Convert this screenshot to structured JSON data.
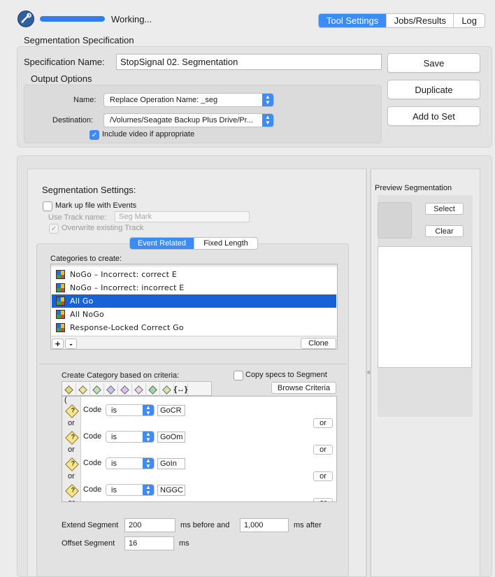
{
  "status": {
    "text": "Working...",
    "progress": 1.0
  },
  "tabs": [
    "Tool Settings",
    "Jobs/Results",
    "Log"
  ],
  "spec": {
    "header": "Segmentation Specification",
    "name_label": "Specification Name:",
    "name_value": "StopSignal 02. Segmentation",
    "output_header": "Output Options",
    "out_name_label": "Name:",
    "out_name_value": "Replace Operation Name: _seg",
    "dest_label": "Destination:",
    "dest_value": "/Volumes/Seagate Backup Plus Drive/Pr...",
    "include_video": "Include video if appropriate",
    "save": "Save",
    "duplicate": "Duplicate",
    "add_to_set": "Add to Set"
  },
  "seg": {
    "header": "Segmentation Settings:",
    "markup": "Mark up file with Events",
    "track_label": "Use Track name:",
    "track_placeholder": "Seg Mark",
    "overwrite": "Overwrite existing Track",
    "tabs": [
      "Event Related",
      "Fixed Length"
    ],
    "categories_label": "Categories to create:",
    "categories": [
      "NoGo – Incorrect: correct E",
      "NoGo – Incorrect: incorrect E",
      "All Go",
      "All NoGo",
      "Response-Locked Correct Go"
    ],
    "add": "+",
    "remove": "-",
    "clone": "Clone",
    "criteria_label": "Create Category based on criteria:",
    "copy_specs": "Copy specs to Segment",
    "browse": "Browse Criteria",
    "paren": "(",
    "criteria": [
      {
        "field": "Code",
        "op": "is",
        "value": "GoCR"
      },
      {
        "field": "Code",
        "op": "is",
        "value": "GoOm"
      },
      {
        "field": "Code",
        "op": "is",
        "value": "GoIn"
      },
      {
        "field": "Code",
        "op": "is",
        "value": "NGGC"
      }
    ],
    "or": "or",
    "extend_label": "Extend Segment",
    "before_value": "200",
    "before_label": "ms before and",
    "after_value": "1,000",
    "after_label": "ms after",
    "offset_label": "Offset Segment",
    "offset_value": "16",
    "offset_unit": "ms"
  },
  "preview": {
    "header": "Preview Segmentation",
    "select": "Select",
    "clear": "Clear"
  },
  "colors": {
    "accent": "#3d8bf7",
    "selection": "#1763d6"
  }
}
